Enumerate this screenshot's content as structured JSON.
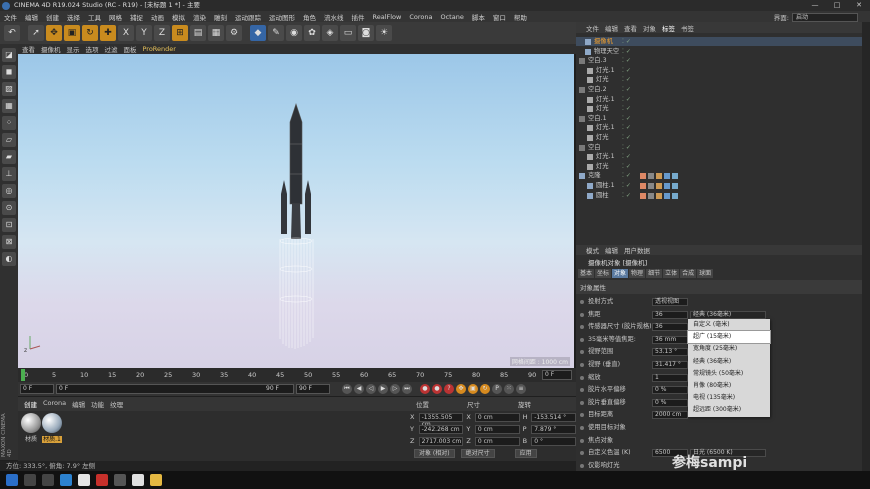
{
  "window": {
    "title": "CINEMA 4D R19.024 Studio (RC - R19) - [未标题 1 *] - 主要",
    "min": "—",
    "max": "□",
    "close": "✕"
  },
  "menu": {
    "items": [
      "文件",
      "编辑",
      "创建",
      "选择",
      "工具",
      "网格",
      "捕捉",
      "动画",
      "模拟",
      "渲染",
      "雕刻",
      "运动跟踪",
      "运动图形",
      "角色",
      "流水线",
      "插件",
      "RealFlow",
      "Corona",
      "Octane",
      "脚本",
      "窗口",
      "帮助"
    ],
    "interface_label": "界面:",
    "interface_value": "启动"
  },
  "viewport": {
    "menu": [
      "查看",
      "摄像机",
      "显示",
      "选项",
      "过滤",
      "面板"
    ],
    "prorender": "ProRender",
    "info": "网格间距 : 1000 cm"
  },
  "timeline": {
    "ticks": [
      "0",
      "5",
      "10",
      "15",
      "20",
      "25",
      "30",
      "35",
      "40",
      "45",
      "50",
      "55",
      "60",
      "65",
      "70",
      "75",
      "80",
      "85",
      "90"
    ],
    "current": "0 F",
    "start": "0 F",
    "range_start": "0 F",
    "range_end": "90 F",
    "end": "90 F"
  },
  "materials": {
    "tabs": [
      "创建",
      "Corona",
      "编辑",
      "功能",
      "纹理"
    ],
    "items": [
      {
        "label": "材质"
      },
      {
        "label": "材质.1"
      }
    ],
    "side_label": "MAXON CINEMA 4D"
  },
  "coords": {
    "headers": [
      "位置",
      "尺寸",
      "旋转"
    ],
    "rows": [
      {
        "axis": "X",
        "pos": "-1355.505 cm",
        "size_axis": "X",
        "size": "0 cm",
        "rot_axis": "H",
        "rot": "-153.514 °"
      },
      {
        "axis": "Y",
        "pos": "-242.268 cm",
        "size_axis": "Y",
        "size": "0 cm",
        "rot_axis": "P",
        "rot": "7.879 °"
      },
      {
        "axis": "Z",
        "pos": "2717.003 cm",
        "size_axis": "Z",
        "size": "0 cm",
        "rot_axis": "B",
        "rot": "0 °"
      }
    ],
    "mode1": "对象 (相对)",
    "mode2": "绝对尺寸",
    "apply": "应用"
  },
  "status": "方位: 333.5°, 俯角: 7.9° 左侧",
  "object_manager": {
    "menu": [
      "文件",
      "编辑",
      "查看",
      "对象",
      "标签",
      "书签"
    ],
    "objects": [
      {
        "name": "摄像机",
        "selected": true
      },
      {
        "name": "物理天空",
        "selected": false
      },
      {
        "name": "空白.3",
        "selected": false
      },
      {
        "name": "灯光.1",
        "selected": false
      },
      {
        "name": "灯光",
        "selected": false
      },
      {
        "name": "空白.2",
        "selected": false
      },
      {
        "name": "灯光.1",
        "selected": false
      },
      {
        "name": "灯光",
        "selected": false
      },
      {
        "name": "空白.1",
        "selected": false
      },
      {
        "name": "灯光.1",
        "selected": false
      },
      {
        "name": "灯光",
        "selected": false
      },
      {
        "name": "空白",
        "selected": false
      },
      {
        "name": "灯光.1",
        "selected": false
      },
      {
        "name": "灯光",
        "selected": false
      },
      {
        "name": "克隆",
        "selected": false
      },
      {
        "name": "圆柱.1",
        "selected": false
      },
      {
        "name": "圆柱",
        "selected": false
      }
    ]
  },
  "attributes": {
    "menu": [
      "模式",
      "编辑",
      "用户数据"
    ],
    "title": "摄像机对象 [摄像机]",
    "tabs": [
      "基本",
      "坐标",
      "对象",
      "物理",
      "细节",
      "立体",
      "合成",
      "球面"
    ],
    "section": "对象属性",
    "rows": [
      {
        "label": "投射方式",
        "value": "透视视图"
      },
      {
        "label": "焦距",
        "value": "36",
        "unit": "经典 (36毫米)"
      },
      {
        "label": "传感器尺寸 (胶片规格)",
        "value": "36",
        "unit": ""
      },
      {
        "label": "35毫米等值焦距:",
        "value": "36 mm",
        "unit": ""
      },
      {
        "label": "视野范围",
        "value": "53.13 °",
        "unit": ""
      },
      {
        "label": "视野 (垂直)",
        "value": "31.417 °",
        "unit": ""
      },
      {
        "label": "缩放",
        "value": "1",
        "unit": ""
      },
      {
        "label": "胶片水平偏移",
        "value": "0 %",
        "unit": ""
      },
      {
        "label": "胶片垂直偏移",
        "value": "0 %",
        "unit": ""
      },
      {
        "label": "目标距离",
        "value": "2000 cm",
        "unit": ""
      },
      {
        "label": "使用目标对象",
        "value": "",
        "unit": ""
      },
      {
        "label": "焦点对象",
        "value": "",
        "unit": ""
      },
      {
        "label": "自定义色温 (K)",
        "value": "6500",
        "unit": "日光 (6500 K)"
      },
      {
        "label": "仅影响灯光",
        "value": "",
        "unit": ""
      }
    ],
    "focal_options": [
      "自定义 (毫米)",
      "超广 (15毫米)",
      "宽角度 (25毫米)",
      "经典 (36毫米)",
      "常规镜头 (50毫米)",
      "肖像 (80毫米)",
      "电视 (135毫米)",
      "超远距 (300毫米)"
    ],
    "highlighted_option": 1
  },
  "watermark": "参梅sampi"
}
